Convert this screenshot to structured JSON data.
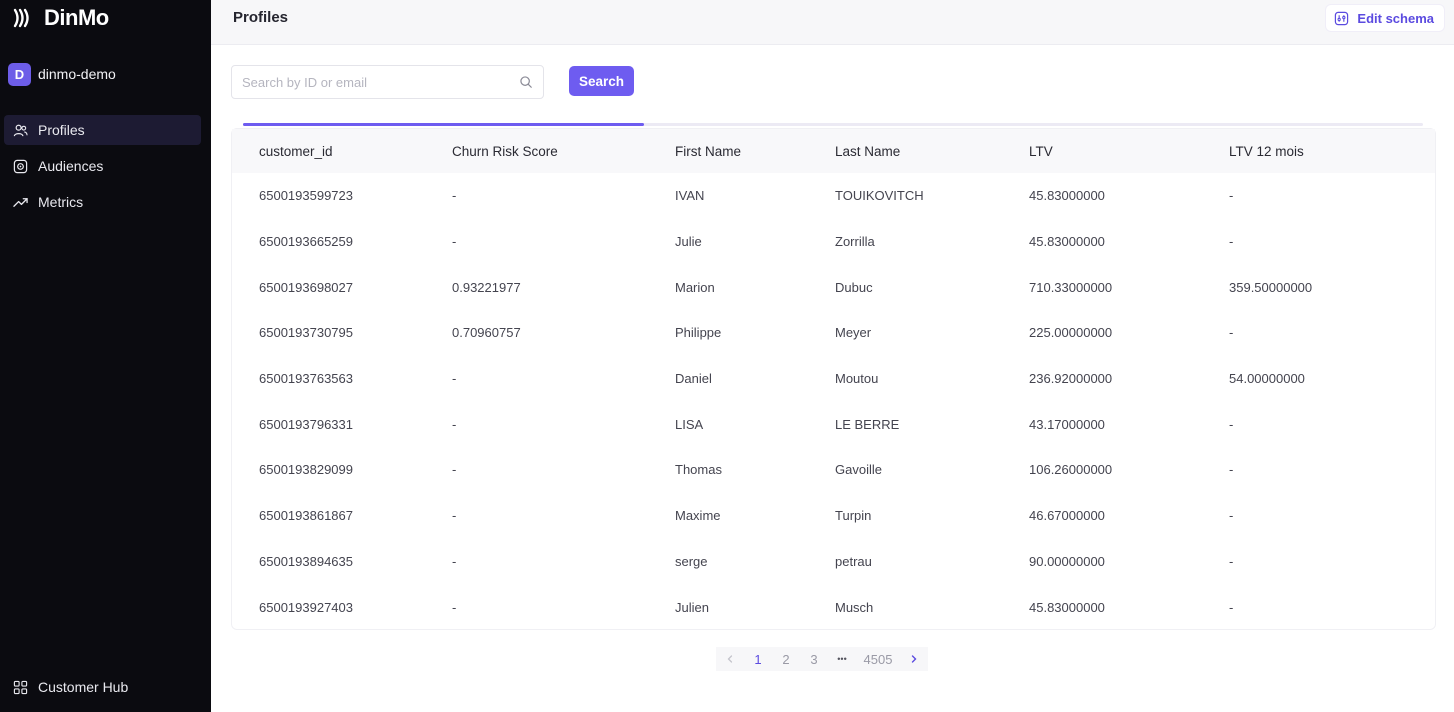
{
  "app": {
    "logo_text": "DinMo",
    "workspace": {
      "initial": "D",
      "name": "dinmo-demo"
    }
  },
  "sidebar": {
    "items": [
      {
        "label": "Profiles",
        "icon": "users-icon",
        "active": true
      },
      {
        "label": "Audiences",
        "icon": "audience-icon",
        "active": false
      },
      {
        "label": "Metrics",
        "icon": "trend-up-icon",
        "active": false
      }
    ],
    "footer": {
      "label": "Customer Hub",
      "icon": "grid-icon"
    }
  },
  "header": {
    "title": "Profiles",
    "edit_schema_label": "Edit schema"
  },
  "search": {
    "placeholder": "Search by ID or email",
    "value": "",
    "button_label": "Search"
  },
  "table": {
    "columns": [
      "customer_id",
      "Churn Risk Score",
      "First Name",
      "Last Name",
      "LTV",
      "LTV 12 mois"
    ],
    "rows": [
      [
        "6500193599723",
        "-",
        "IVAN",
        "TOUIKOVITCH",
        "45.83000000",
        "-"
      ],
      [
        "6500193665259",
        "-",
        "Julie",
        "Zorrilla",
        "45.83000000",
        "-"
      ],
      [
        "6500193698027",
        "0.93221977",
        "Marion",
        "Dubuc",
        "710.33000000",
        "359.50000000"
      ],
      [
        "6500193730795",
        "0.70960757",
        "Philippe",
        "Meyer",
        "225.00000000",
        "-"
      ],
      [
        "6500193763563",
        "-",
        "Daniel",
        "Moutou",
        "236.92000000",
        "54.00000000"
      ],
      [
        "6500193796331",
        "-",
        "LISA",
        "LE BERRE",
        "43.17000000",
        "-"
      ],
      [
        "6500193829099",
        "-",
        "Thomas",
        "Gavoille",
        "106.26000000",
        "-"
      ],
      [
        "6500193861867",
        "-",
        "Maxime",
        "Turpin",
        "46.67000000",
        "-"
      ],
      [
        "6500193894635",
        "-",
        "serge",
        "petrau",
        "90.00000000",
        "-"
      ],
      [
        "6500193927403",
        "-",
        "Julien",
        "Musch",
        "45.83000000",
        "-"
      ]
    ]
  },
  "pagination": {
    "pages": [
      "1",
      "2",
      "3"
    ],
    "ellipsis": "•••",
    "last_page": "4505",
    "current": "1"
  },
  "colors": {
    "accent": "#6e5cf0",
    "sidebar_bg": "#0b0b10",
    "active_nav_bg": "#1d1b33"
  }
}
